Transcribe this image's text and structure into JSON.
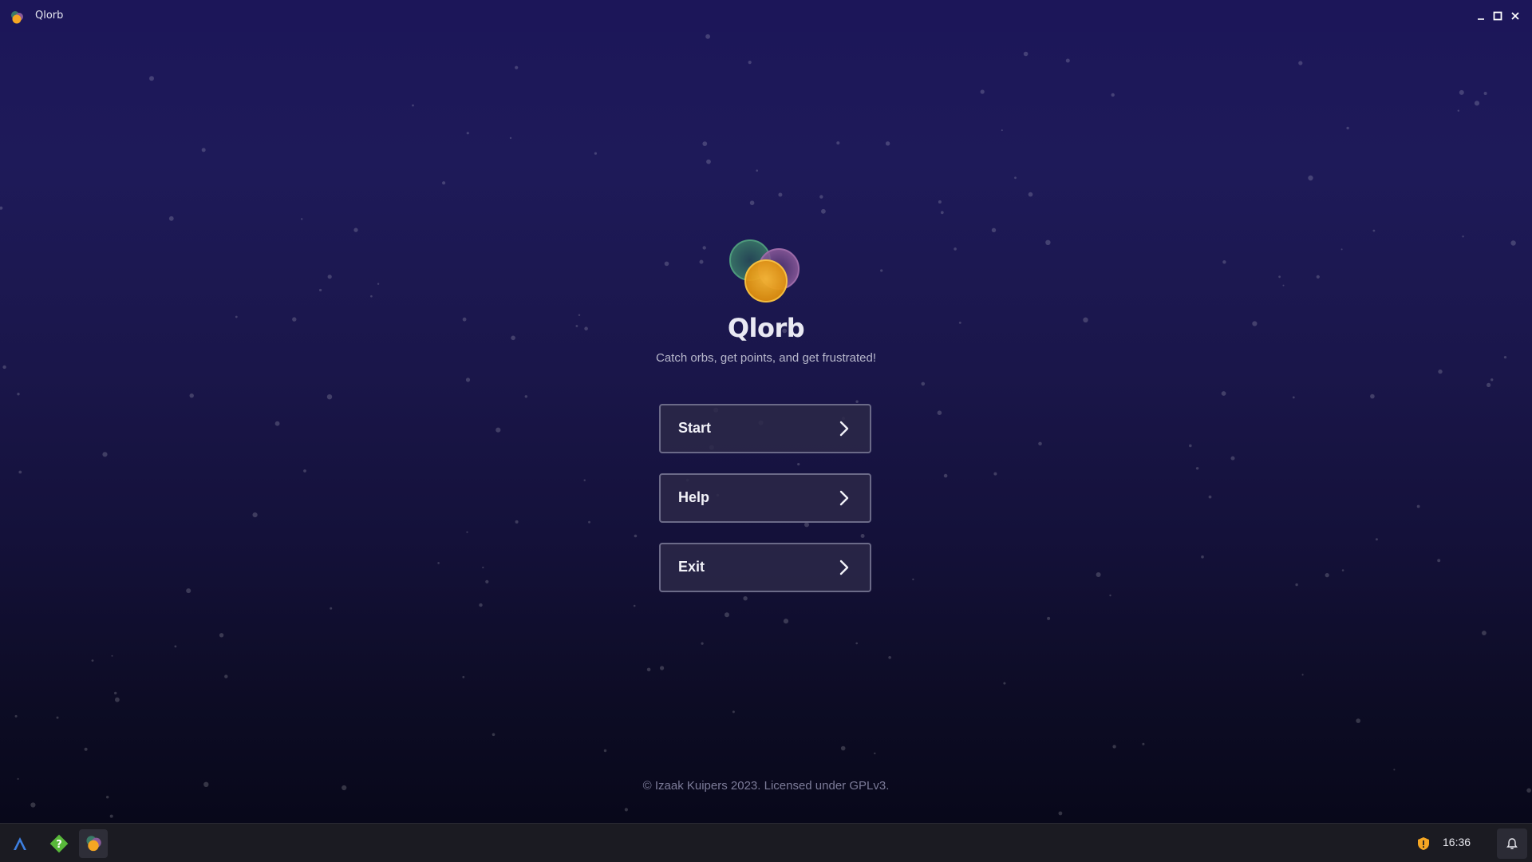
{
  "window": {
    "title": "Qlorb",
    "app_icon": "qlorb-orb-icon",
    "controls": [
      "minimize-icon",
      "maximize-icon",
      "close-icon"
    ]
  },
  "game": {
    "logo_icon": "qlorb-orbs-logo",
    "name": "Qlorb",
    "tagline": "Catch orbs, get points, and get frustrated!",
    "menu": [
      {
        "label": "Start",
        "icon": "chevron-right-icon"
      },
      {
        "label": "Help",
        "icon": "chevron-right-icon"
      },
      {
        "label": "Exit",
        "icon": "chevron-right-icon"
      }
    ],
    "footer": "© Izaak Kuipers 2023. Licensed under GPLv3."
  },
  "taskbar": {
    "launcher_icon": "launcher-icon",
    "apps": [
      "help-app-icon",
      "qlorb-app-icon"
    ],
    "tray_icon": "shield-warning-icon",
    "clock": "16:36",
    "notification_icon": "bell-icon"
  },
  "colors": {
    "background_top": "#1c1659",
    "background_bottom": "#08081a",
    "button_border": "#6b6a88",
    "orb_green": "#3a7a68",
    "orb_purple": "#8a5a9a",
    "orb_orange": "#f5a623",
    "shield": "#f5a623"
  }
}
